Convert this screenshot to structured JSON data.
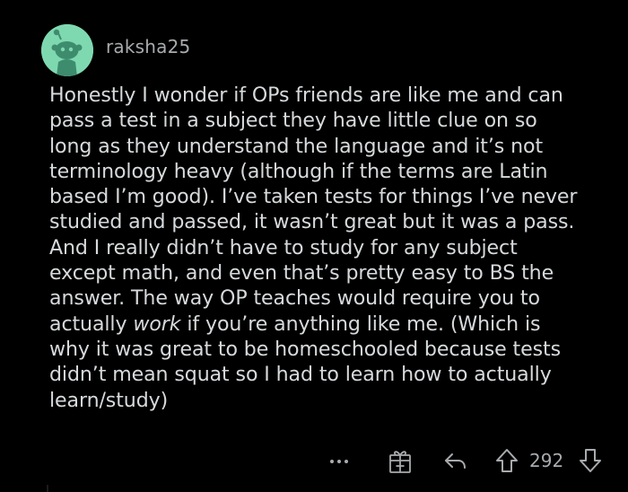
{
  "comment": {
    "author": "raksha25",
    "lines": [
      "Honestly I wonder if OPs friends are like me and can",
      "pass a test in a subject they have little clue on so",
      "long as they understand the language and it’s not",
      "terminology heavy (although if the terms are Latin",
      "based I’m good). I’ve taken tests for things I’ve never",
      "studied and passed, it wasn’t great but it was a pass.",
      "And I really didn’t have to study for any subject",
      "except math, and even that’s pretty easy to BS the",
      "answer. The way OP teaches would require you to"
    ],
    "line10": {
      "before": "actually ",
      "emphasis": "work",
      "after": " if you’re anything like me. (Which is"
    },
    "lines_end": [
      "why it was great to be homeschooled because tests",
      "didn’t mean squat so I had to learn how to actually",
      "learn/study)"
    ]
  },
  "actions": {
    "more": "•••",
    "vote_count": "292"
  },
  "colors": {
    "background": "#000000",
    "text": "#D7DADC",
    "muted": "#A8ABAE",
    "avatar_bg": "#7FD9B0",
    "avatar_figure": "#3E8C6E"
  },
  "icons": [
    "avatar",
    "more-options-icon",
    "award-icon",
    "reply-icon",
    "upvote-icon",
    "downvote-icon"
  ]
}
